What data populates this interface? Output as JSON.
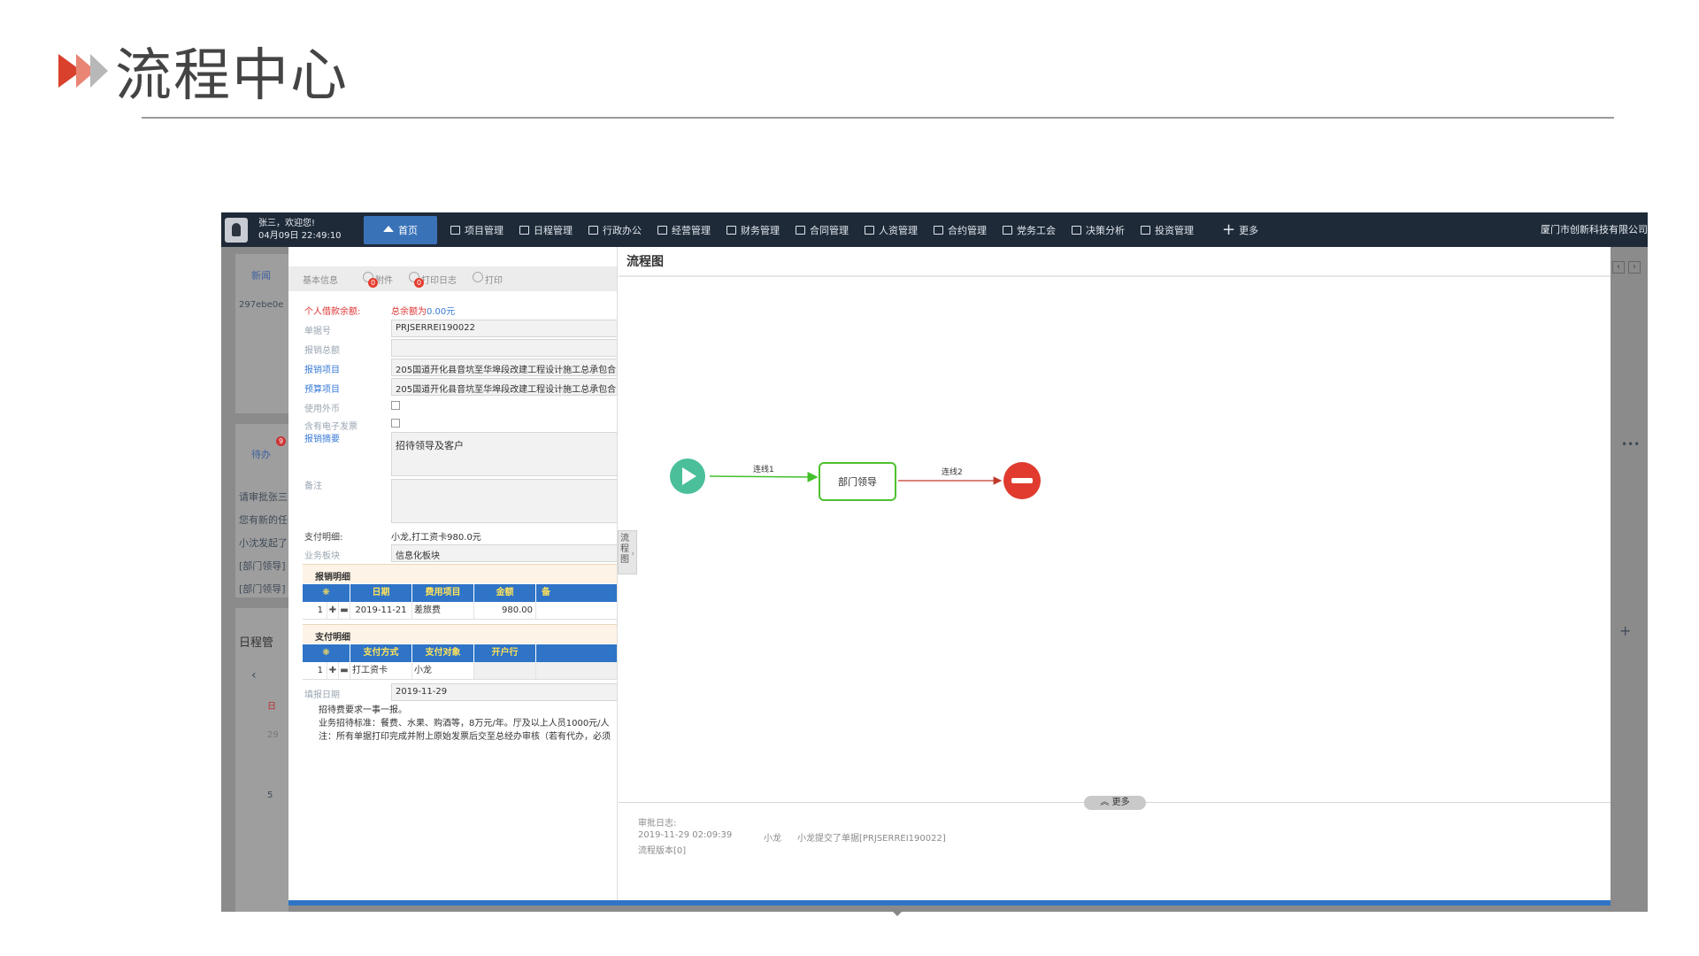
{
  "slide": {
    "title": "流程中心"
  },
  "topnav": {
    "user_greeting": "张三，欢迎您!",
    "user_datetime": "04月09日 22:49:10",
    "items": [
      {
        "label": "首页",
        "icon": "home-icon"
      },
      {
        "label": "项目管理",
        "icon": "grid-icon"
      },
      {
        "label": "日程管理",
        "icon": "calendar-icon"
      },
      {
        "label": "行政办公",
        "icon": "office-icon"
      },
      {
        "label": "经营管理",
        "icon": "chart-icon"
      },
      {
        "label": "财务管理",
        "icon": "finance-icon"
      },
      {
        "label": "合同管理",
        "icon": "contract-icon"
      },
      {
        "label": "人资管理",
        "icon": "people-icon"
      },
      {
        "label": "合约管理",
        "icon": "edit-icon"
      },
      {
        "label": "党务工会",
        "icon": "doc-icon"
      },
      {
        "label": "决策分析",
        "icon": "analysis-icon"
      },
      {
        "label": "投资管理",
        "icon": "invest-icon"
      }
    ],
    "more": "更多",
    "company": "厦门市创新科技有限公司"
  },
  "background": {
    "news_tab": "新闻",
    "image_alt": "297ebe0e",
    "todo_tab": "待办",
    "todo_badge": "9",
    "todo_items": [
      "请审批张三",
      "您有新的任",
      "小沈发起了",
      "[部门领导]",
      "[部门领导]"
    ],
    "schedule_title": "日程管",
    "calendar_prev": "‹",
    "calendar_day": "日",
    "calendar_num1": "29",
    "calendar_num2": "5"
  },
  "form": {
    "tabs": {
      "basic": "基本信息",
      "attachment": "附件",
      "attachment_badge": "0",
      "print_log": "打印日志",
      "print_log_badge": "0",
      "print": "打印"
    },
    "fields": {
      "balance_label": "个人借款余额:",
      "balance_prefix": "总余额为",
      "balance_value": "0.00元",
      "doc_no_label": "单据号",
      "doc_no": "PRJSERREI190022",
      "total_label": "报销总额",
      "project_label": "报销项目",
      "project": "205国道开化县音坑至华埠段改建工程设计施工总承包合",
      "budget_label": "预算项目",
      "budget": "205国道开化县音坑至华埠段改建工程设计施工总承包合",
      "foreign_label": "使用外币",
      "einvoice_label": "含有电子发票",
      "summary_label": "报销摘要",
      "summary": "招待领导及客户",
      "remark_label": "备注",
      "payment_label": "支付明细:",
      "payment": "小龙,打工资卡980.0元",
      "segment_label": "业务板块",
      "segment": "信息化板块",
      "fill_date_label": "填报日期",
      "fill_date": "2019-11-29"
    },
    "expense_section": "报销明细",
    "expense_headers": [
      "日期",
      "费用项目",
      "金额",
      "备"
    ],
    "expense_rows": [
      {
        "no": "1",
        "date": "2019-11-21",
        "item": "差旅费",
        "amount": "980.00"
      }
    ],
    "pay_section": "支付明细",
    "pay_headers": [
      "支付方式",
      "支付对象",
      "开户行"
    ],
    "pay_rows": [
      {
        "no": "1",
        "method": "打工资卡",
        "target": "小龙"
      }
    ],
    "notes": [
      "招待费要求一事一报。",
      "业务招待标准：餐费、水果、购酒等，8万元/年。厅及以上人员1000元/人",
      "注：所有单据打印完成并附上原始发票后交至总经办审核（若有代办，必须"
    ]
  },
  "flow": {
    "title": "流程图",
    "collapse_label": "流程图",
    "node_task": "部门领导",
    "edge1": "连线1",
    "edge2": "连线2",
    "more": "更多",
    "log_title": "审批日志:",
    "log_time": "2019-11-29 02:09:39",
    "log_user": "小龙",
    "log_action": "小龙提交了单据[PRJSERREI190022]",
    "log_version": "流程版本[0]"
  },
  "colors": {
    "nav_bg": "#1f2a38",
    "accent": "#2f74c6",
    "start": "#4bbf9a",
    "end": "#e03b2e",
    "task_border": "#4ec12f"
  }
}
